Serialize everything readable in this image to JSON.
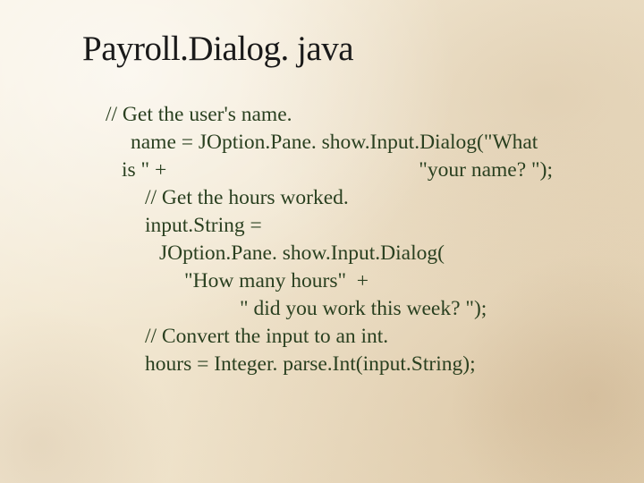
{
  "slide": {
    "title": "Payroll.Dialog. java",
    "code": {
      "line1": "// Get the user's name.",
      "line2": "name = JOption.Pane. show.Input.Dialog(\"What",
      "line2b_a": "is \" +",
      "line2b_b": "\"your name? \");",
      "line3": "// Get the hours worked.",
      "line4": "input.String =",
      "line5": "JOption.Pane. show.Input.Dialog(",
      "line6": "\"How many hours\"  +",
      "line7": "\" did you work this week? \");",
      "line8": "// Convert the input to an int.",
      "line9": "hours = Integer. parse.Int(input.String);"
    }
  }
}
